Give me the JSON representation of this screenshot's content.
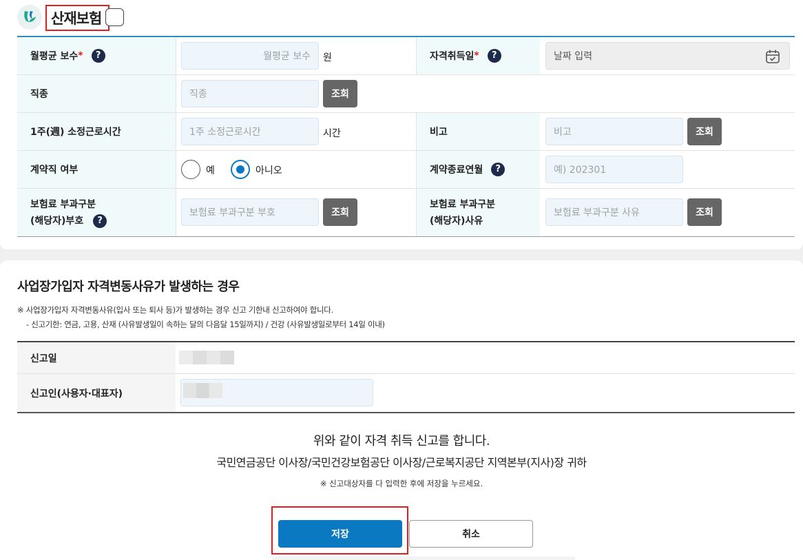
{
  "header": {
    "title": "산재보험"
  },
  "form": {
    "row1": {
      "label": "월평균 보수",
      "required": "*",
      "help": "?",
      "placeholder": "월평균 보수",
      "unit": "원",
      "right_label": "자격취득일",
      "right_required": "*",
      "right_help": "?",
      "date_placeholder": "날짜 입력"
    },
    "row2": {
      "label": "직종",
      "placeholder": "직종",
      "button": "조회"
    },
    "row3": {
      "label": "1주(週) 소정근로시간",
      "placeholder": "1주 소정근로시간",
      "unit": "시간",
      "right_label": "비고",
      "right_placeholder": "비고",
      "right_button": "조회"
    },
    "row4": {
      "label": "계약직 여부",
      "option_yes": "예",
      "option_no": "아니오",
      "selected": "아니오",
      "right_label": "계약종료연월",
      "right_help": "?",
      "right_placeholder": "예) 202301"
    },
    "row5": {
      "label_line1": "보험료 부과구분",
      "label_line2": "(해당자)부호",
      "help": "?",
      "placeholder": "보험료 부과구분 부호",
      "button": "조회",
      "right_label_line1": "보험료 부과구분",
      "right_label_line2": "(해당자)사유",
      "right_placeholder": "보험료 부과구분 사유",
      "right_button": "조회"
    }
  },
  "section": {
    "title": "사업장가입자 자격변동사유가 발생하는 경우",
    "note1": "※  사업장가입자 자격변동사유(입사 또는 퇴사 등)가 발생하는 경우 신고 기한내 신고하여야 합니다.",
    "note2": "-  신고기한: 연금, 고용, 산재 (사유발생일이 속하는 달의 다음달 15일까지) / 건강 (사유발생일로부터 14일 이내)"
  },
  "report": {
    "date_label": "신고일",
    "reporter_label": "신고인(사용자·대표자)"
  },
  "declaration": {
    "line1": "위와 같이 자격 취득 신고를 합니다.",
    "line2": "국민연금공단 이사장/국민건강보험공단 이사장/근로복지공단 지역본부(지사)장 귀하",
    "line3": "※  신고대상자를 다 입력한 후에 저장을 누르세요."
  },
  "buttons": {
    "save": "저장",
    "cancel": "취소"
  },
  "colors": {
    "accent": "#0a79c2",
    "header_rule": "#2a8fc0",
    "highlight": "#e02020"
  }
}
